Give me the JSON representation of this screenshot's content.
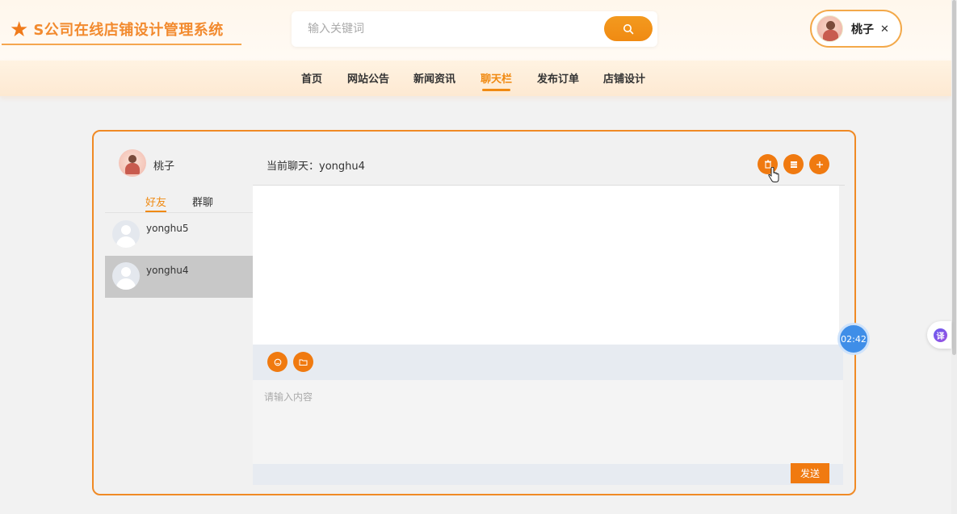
{
  "header": {
    "logo_text": "S公司在线店铺设计管理系统",
    "search_placeholder": "输入关键词",
    "user_name": "桃子"
  },
  "nav": {
    "items": [
      {
        "label": "首页"
      },
      {
        "label": "网站公告"
      },
      {
        "label": "新闻资讯"
      },
      {
        "label": "聊天栏"
      },
      {
        "label": "发布订单"
      },
      {
        "label": "店铺设计"
      }
    ],
    "active": "聊天栏"
  },
  "chat": {
    "me_name": "桃子",
    "current_chat": "当前聊天：yonghu4",
    "tabs": [
      "好友",
      "群聊"
    ],
    "friends": [
      {
        "name": "yonghu5"
      },
      {
        "name": "yonghu4"
      }
    ],
    "selected_friend": "yonghu4",
    "input_placeholder": "请输入内容",
    "send_label": "发送"
  },
  "floating": {
    "timer": "02:42",
    "translate_glyph": "译"
  },
  "colors": {
    "accent": "#f07a10",
    "logo": "#f28a2e",
    "timer": "#3f8ee8"
  }
}
